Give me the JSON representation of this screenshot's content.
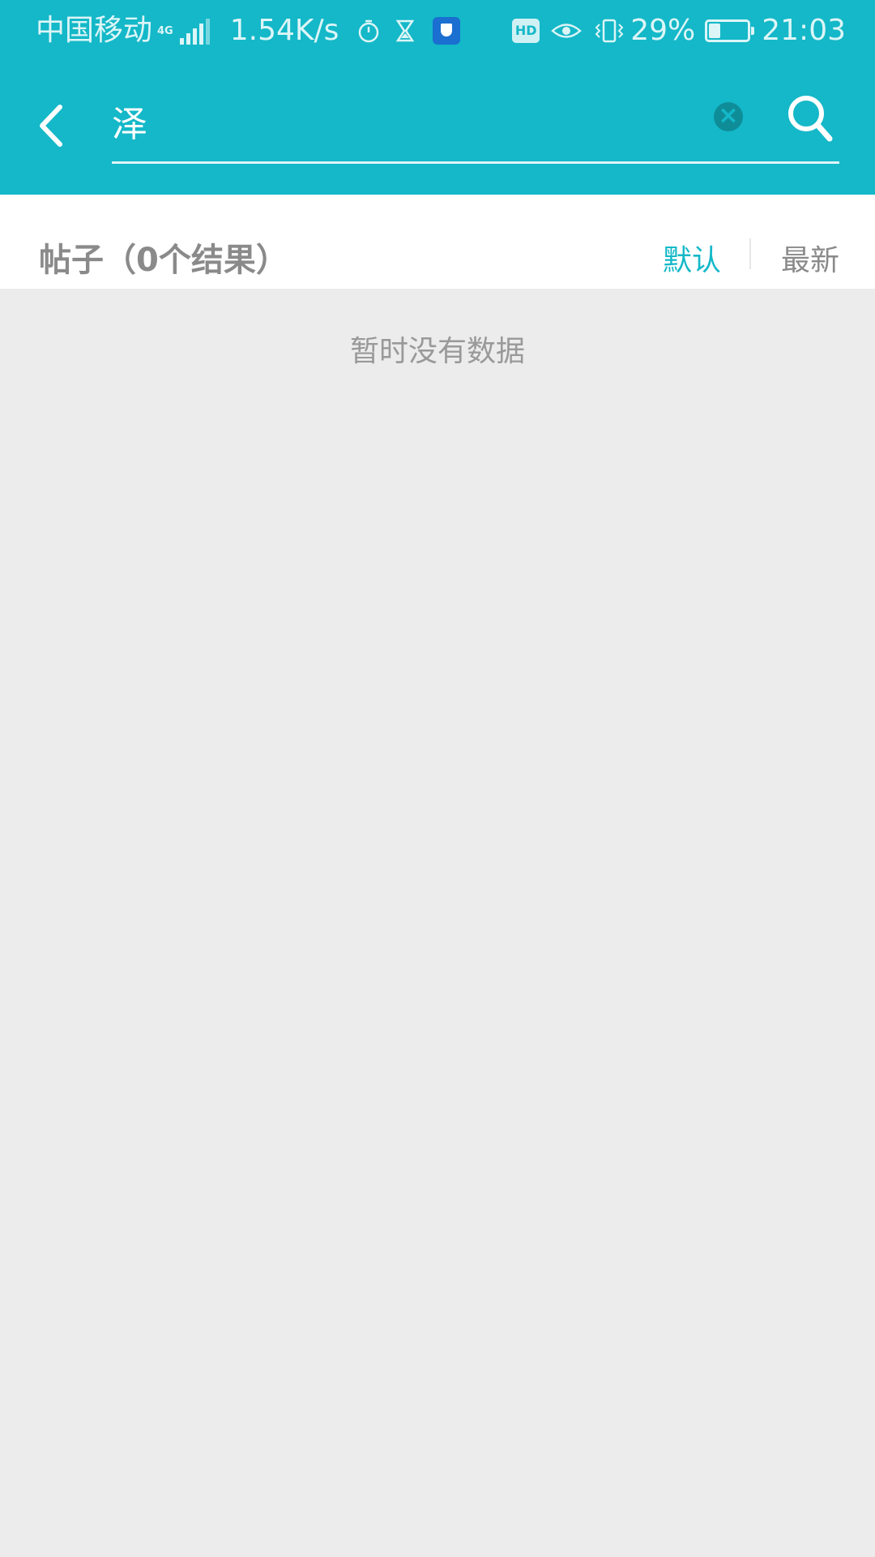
{
  "status_bar": {
    "carrier": "中国移动",
    "network": "4G",
    "speed": "1.54K/s",
    "battery_percent": "29%",
    "battery_level": 0.29,
    "time": "21:03"
  },
  "search": {
    "query": "泽"
  },
  "results": {
    "title": "帖子（0个结果）",
    "sort_default": "默认",
    "sort_newest": "最新"
  },
  "empty_message": "暂时没有数据",
  "colors": {
    "accent": "#14b8c8",
    "background": "#ececec"
  }
}
